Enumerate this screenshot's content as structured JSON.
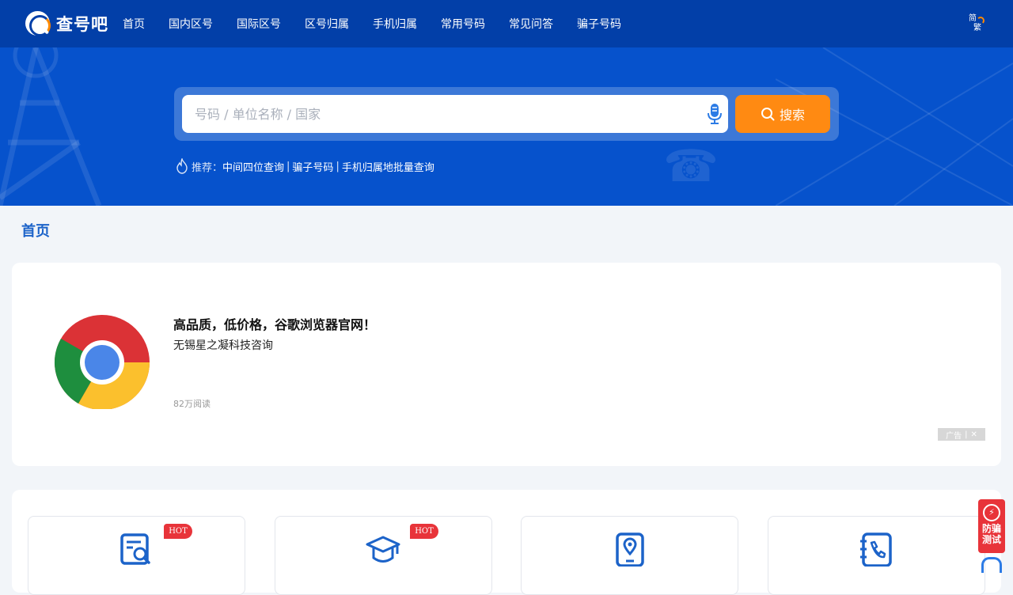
{
  "brand": {
    "name": "查号吧"
  },
  "nav": [
    {
      "label": "首页"
    },
    {
      "label": "国内区号"
    },
    {
      "label": "国际区号"
    },
    {
      "label": "区号归属"
    },
    {
      "label": "手机归属"
    },
    {
      "label": "常用号码"
    },
    {
      "label": "常见问答"
    },
    {
      "label": "骗子号码"
    }
  ],
  "lang_switch": {
    "simplified": "简",
    "traditional": "繁"
  },
  "search": {
    "placeholder": "号码 / 单位名称 / 国家",
    "value": "",
    "button_label": "搜索"
  },
  "recommend": {
    "label": "推荐：",
    "links": [
      "中间四位查询",
      "骗子号码",
      "手机归属地批量查询"
    ],
    "separator": "|"
  },
  "breadcrumb": {
    "current": "首页"
  },
  "ad": {
    "title": "高品质，低价格，谷歌浏览器官网！",
    "subtitle": "无锡星之凝科技咨询",
    "reads": "82万阅读",
    "tag": "广告",
    "close": "✕"
  },
  "services": [
    {
      "icon": "search-doc-icon",
      "badge": "HOT"
    },
    {
      "icon": "graduation-cap-icon",
      "badge": "HOT"
    },
    {
      "icon": "phone-location-icon",
      "badge": ""
    },
    {
      "icon": "phone-book-icon",
      "badge": ""
    }
  ],
  "float": {
    "anti_fraud": "防骗测试"
  },
  "colors": {
    "header": "#023fa8",
    "hero": "#0652cc",
    "accent": "#ff8a12",
    "link": "#1c63c9",
    "hot": "#e8343a"
  }
}
